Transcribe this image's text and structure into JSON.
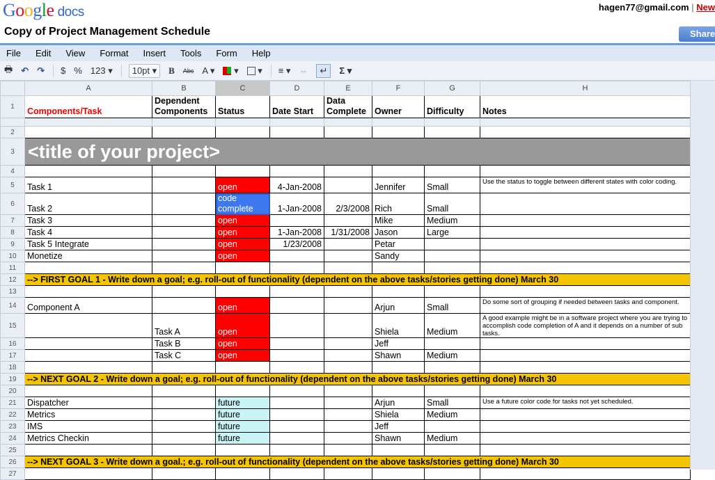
{
  "app": {
    "logo_google": "Google",
    "logo_docs": "docs",
    "user_email": "hagen77@gmail.com",
    "separator": "|",
    "new_link": "New",
    "doc_title": "Copy of Project Management Schedule",
    "share_label": "Share"
  },
  "menu": [
    "File",
    "Edit",
    "View",
    "Format",
    "Insert",
    "Tools",
    "Form",
    "Help"
  ],
  "toolbar": {
    "currency": "$",
    "percent": "%",
    "number_format": "123 ▾",
    "font_size": "10pt ▾",
    "bold": "B",
    "strike": "Abc",
    "font_color": "A ▾",
    "sum": "Σ ▾"
  },
  "columns": [
    "A",
    "B",
    "C",
    "D",
    "E",
    "F",
    "G",
    "H"
  ],
  "selected_column": "C",
  "header_row": {
    "A": "Components/Task",
    "B": "Dependent Components",
    "C": "Status",
    "D": "Date Start",
    "E": "Data Complete",
    "F": "Owner",
    "G": "Difficulty",
    "H": "Notes"
  },
  "colors": {
    "open": "#ff0000",
    "code_complete": "#3d78f0",
    "future": "#c9f3f5",
    "goal": "#f5c400",
    "title": "#999999"
  },
  "rows": [
    {
      "n": "2"
    },
    {
      "n": "3",
      "title": "<title of your project>"
    },
    {
      "n": "4"
    },
    {
      "n": "5",
      "A": "Task 1",
      "C": "open",
      "D": "4-Jan-2008",
      "F": "Jennifer",
      "G": "Small",
      "H": "Use the status to toggle between different states with color coding."
    },
    {
      "n": "6",
      "A": "Task 2",
      "C": "code complete",
      "D": "1-Jan-2008",
      "E": "2/3/2008",
      "F": "Rich",
      "G": "Small"
    },
    {
      "n": "7",
      "A": "Task 3",
      "C": "open",
      "F": "Mike",
      "G": "Medium"
    },
    {
      "n": "8",
      "A": "Task 4",
      "C": "open",
      "D": "1-Jan-2008",
      "E": "1/31/2008",
      "F": "Jason",
      "G": "Large"
    },
    {
      "n": "9",
      "A": "Task 5 Integrate",
      "C": "open",
      "D": "1/23/2008",
      "F": "Petar"
    },
    {
      "n": "10",
      "A": "Monetize",
      "C": "open",
      "F": "Sandy"
    },
    {
      "n": "11"
    },
    {
      "n": "12",
      "goal": "--> FIRST GOAL 1 - Write down a goal; e.g. roll-out of functionality (dependent on the above tasks/stories getting done) March 30"
    },
    {
      "n": "13"
    },
    {
      "n": "14",
      "A": "Component A",
      "C": "open",
      "F": "Arjun",
      "G": "Small",
      "H": "Do some sort of grouping if needed between tasks and component."
    },
    {
      "n": "15",
      "B": "Task A",
      "C": "open",
      "F": "Shiela",
      "G": "Medium",
      "H": "A good example might be in a software project where you are trying to accomplish code completion of A and it depends on a number of sub tasks."
    },
    {
      "n": "16",
      "B": "Task B",
      "C": "open",
      "F": "Jeff"
    },
    {
      "n": "17",
      "B": "Task C",
      "C": "open",
      "F": "Shawn",
      "G": "Medium"
    },
    {
      "n": "18"
    },
    {
      "n": "19",
      "goal": "--> NEXT GOAL 2 - Write down a goal; e.g. roll-out of functionality (dependent on the above tasks/stories getting done) March 30"
    },
    {
      "n": "20"
    },
    {
      "n": "21",
      "A": "Dispatcher",
      "C": "future",
      "F": "Arjun",
      "G": "Small",
      "H": "Use a future color code for tasks not yet scheduled."
    },
    {
      "n": "22",
      "A": "Metrics",
      "C": "future",
      "F": "Shiela",
      "G": "Medium"
    },
    {
      "n": "23",
      "A": "IMS",
      "C": "future",
      "F": "Jeff"
    },
    {
      "n": "24",
      "A": "Metrics Checkin",
      "C": "future",
      "F": "Shawn",
      "G": "Medium"
    },
    {
      "n": "25"
    },
    {
      "n": "26",
      "goal": "--> NEXT GOAL 3 - Write down a goal.; e.g. roll-out of functionality (dependent on the above tasks/stories getting done) March 30"
    },
    {
      "n": "27"
    }
  ]
}
